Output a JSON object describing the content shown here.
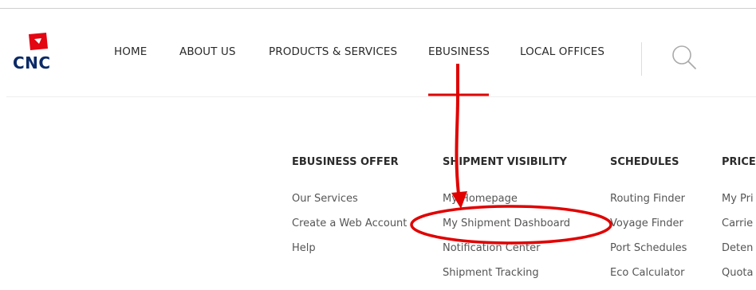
{
  "brand": {
    "name": "CNC",
    "accent": "#e30613",
    "navy": "#0b2a66"
  },
  "nav": {
    "items": [
      {
        "id": "home",
        "label": "HOME"
      },
      {
        "id": "about",
        "label": "ABOUT US"
      },
      {
        "id": "products",
        "label": "PRODUCTS & SERVICES"
      },
      {
        "id": "ebusiness",
        "label": "EBUSINESS"
      },
      {
        "id": "offices",
        "label": "LOCAL OFFICES"
      }
    ],
    "search_icon": "search-icon"
  },
  "menu": {
    "columns": [
      {
        "heading": "EBUSINESS OFFER",
        "items": [
          "Our Services",
          "Create a Web Account",
          "Help"
        ]
      },
      {
        "heading": "SHIPMENT VISIBILITY",
        "items": [
          "My Homepage",
          "My Shipment Dashboard",
          "Notification Center",
          "Shipment Tracking"
        ]
      },
      {
        "heading": "SCHEDULES",
        "items": [
          "Routing Finder",
          "Voyage Finder",
          "Port Schedules",
          "Eco Calculator"
        ]
      },
      {
        "heading": "PRICE",
        "items": [
          "My Pri",
          "Carrie",
          "Deten",
          "Quota"
        ]
      }
    ]
  },
  "annotation": {
    "color": "#e00000"
  }
}
